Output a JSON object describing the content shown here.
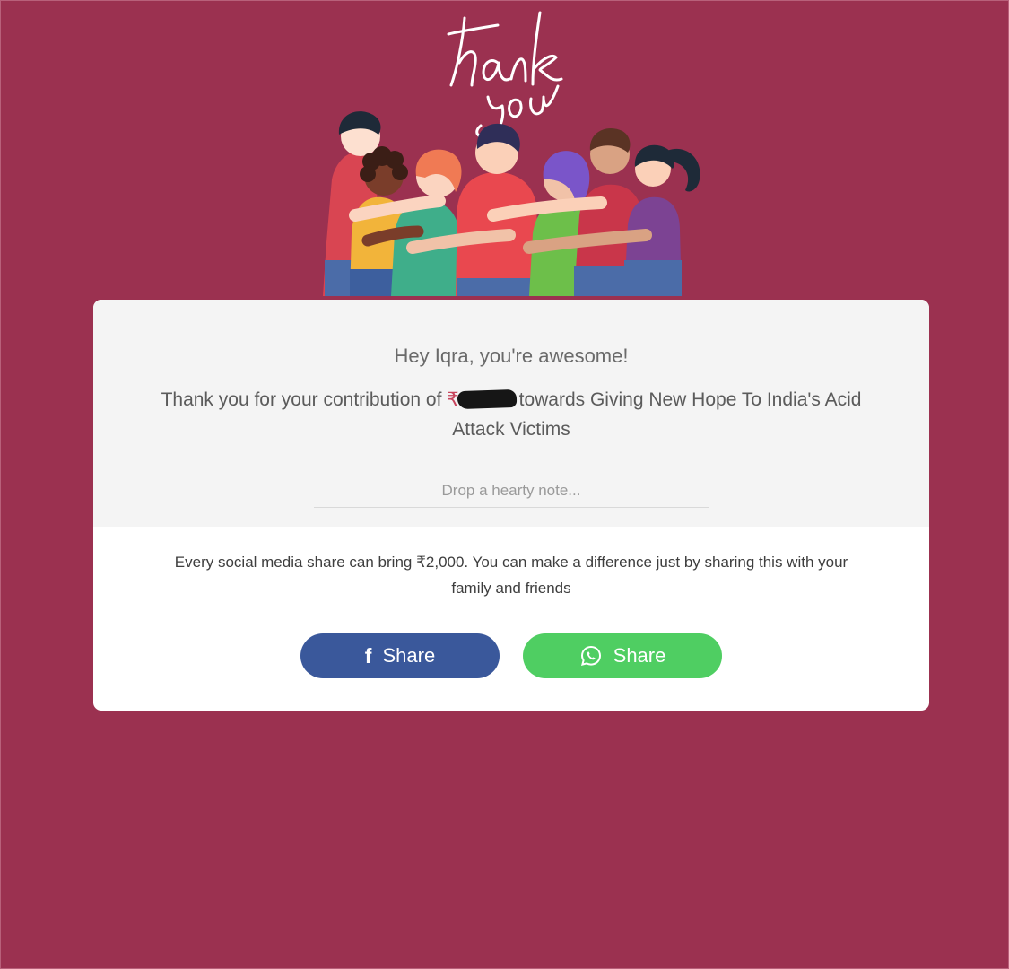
{
  "hero": {
    "title_text": "thank you",
    "illustration": "group-hug-illustration"
  },
  "card": {
    "greeting": "Hey Iqra, you're awesome!",
    "thanks": {
      "prefix": "Thank you for your contribution of ",
      "currency_symbol": "₹",
      "amount_redacted": true,
      "suffix": "towards Giving New Hope To India's Acid Attack Victims"
    },
    "note_input": {
      "placeholder": "Drop a hearty note...",
      "value": ""
    },
    "share_info": "Every social media share can bring ₹2,000. You can make a difference just by sharing this with your family and friends",
    "buttons": {
      "facebook": {
        "label": "Share",
        "icon": "facebook-icon",
        "color": "#3a589b"
      },
      "whatsapp": {
        "label": "Share",
        "icon": "whatsapp-icon",
        "color": "#4fce62"
      }
    }
  },
  "colors": {
    "background": "#9b3150",
    "card": "#ffffff",
    "card_top": "#f4f4f4"
  }
}
